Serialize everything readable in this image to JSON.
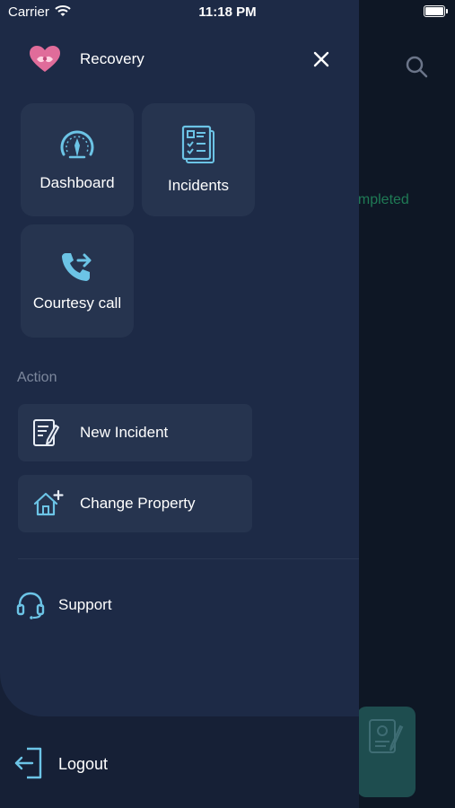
{
  "status_bar": {
    "carrier": "Carrier",
    "time": "11:18 PM"
  },
  "background": {
    "status_text": "ompleted"
  },
  "drawer": {
    "app_name": "Recovery",
    "tiles": [
      {
        "label": "Dashboard",
        "icon": "gauge-icon"
      },
      {
        "label": "Incidents",
        "icon": "incident-list-icon"
      },
      {
        "label": "Courtesy call",
        "icon": "phone-forward-icon"
      }
    ],
    "action_section_label": "Action",
    "actions": [
      {
        "label": "New Incident",
        "icon": "new-incident-icon"
      },
      {
        "label": "Change Property",
        "icon": "change-property-icon"
      }
    ],
    "support_label": "Support",
    "logout_label": "Logout"
  },
  "colors": {
    "accent": "#6cc4e6",
    "drawer": "#1d2a46",
    "tile": "#26344f"
  }
}
